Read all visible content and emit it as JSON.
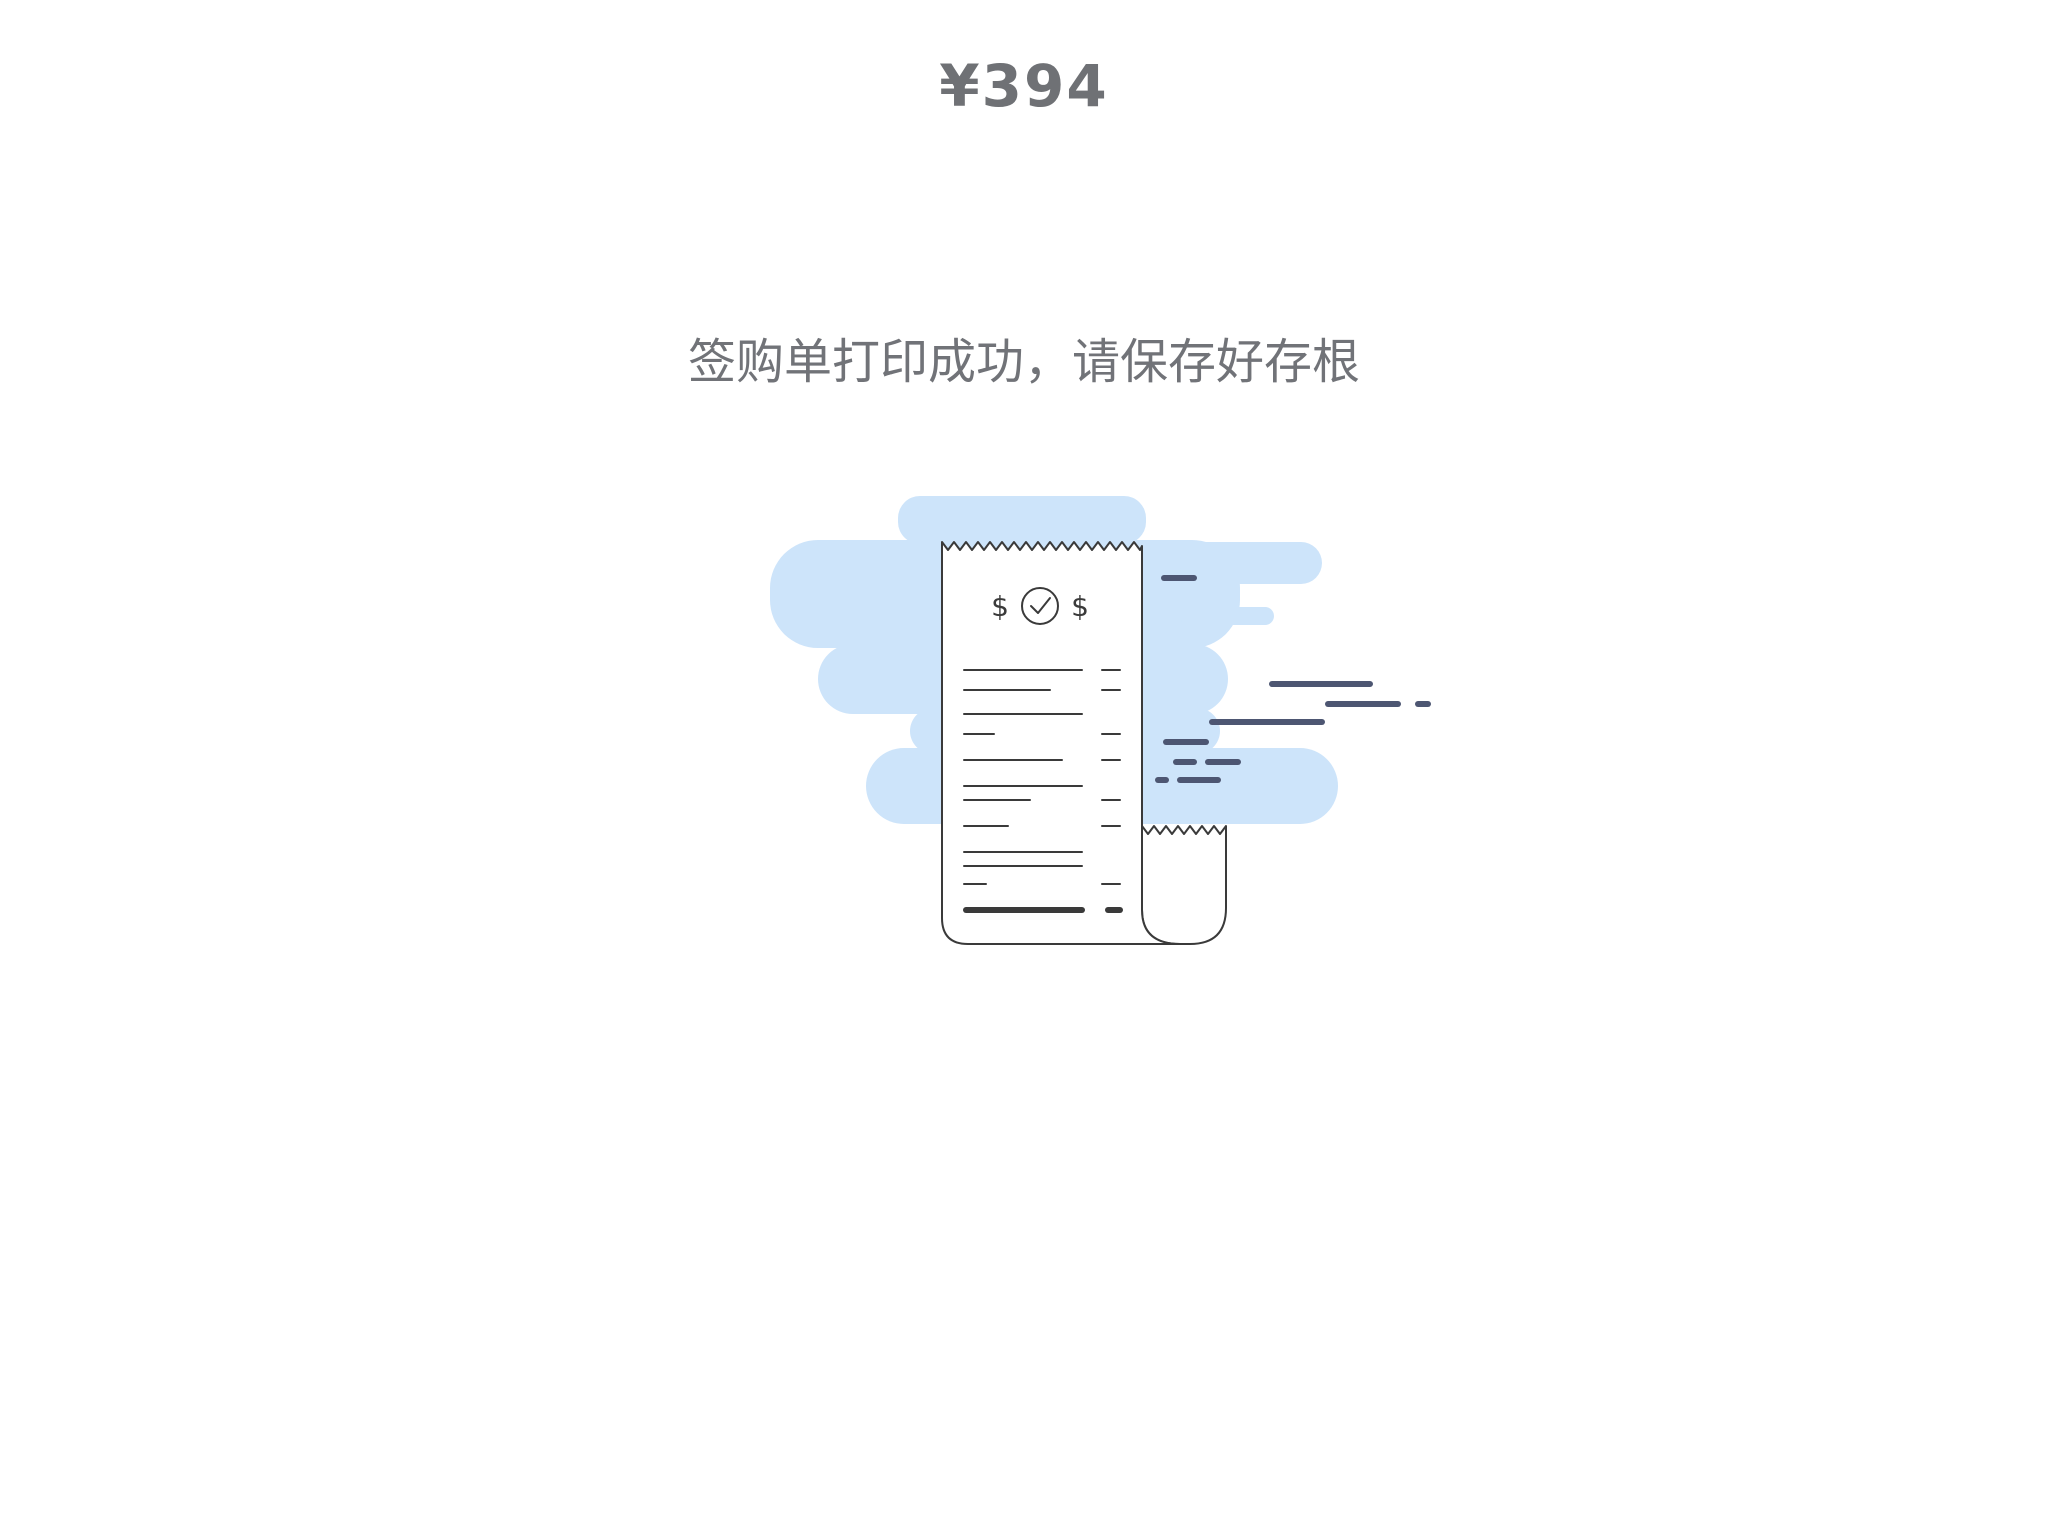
{
  "payment": {
    "amount": "¥394"
  },
  "status": {
    "message": "签购单打印成功，请保存好存根"
  },
  "illustration": {
    "name": "receipt-illustration",
    "currency_symbol": "$",
    "colors": {
      "cloud": "#cde4fa",
      "speed_lines": "#4d5672",
      "outline": "#3a3a3a",
      "paper": "#ffffff"
    }
  }
}
